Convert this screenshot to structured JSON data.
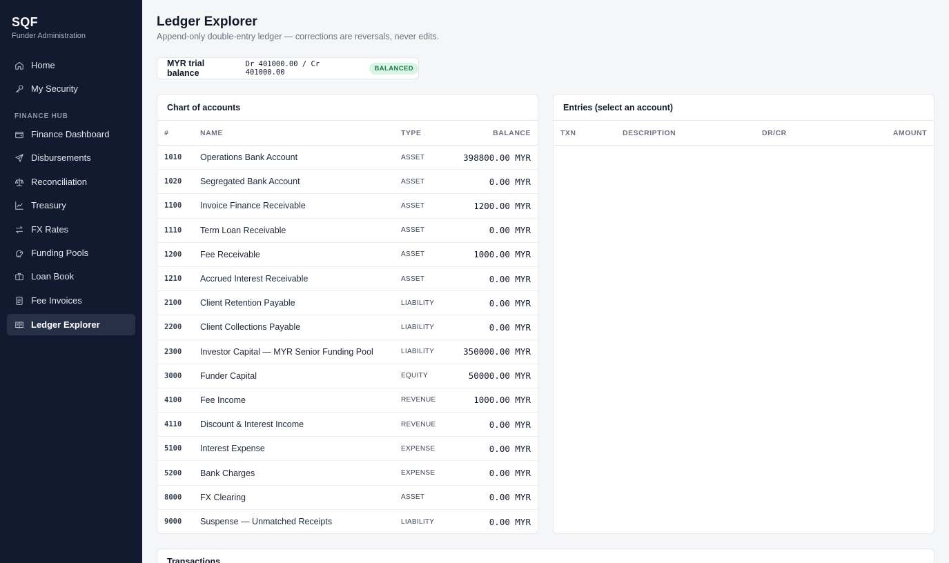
{
  "brand": {
    "title": "SQF",
    "subtitle": "Funder Administration"
  },
  "nav": {
    "top": [
      {
        "label": "Home",
        "icon": "home-icon"
      },
      {
        "label": "My Security",
        "icon": "key-icon"
      }
    ],
    "section_label": "FINANCE HUB",
    "finance": [
      {
        "label": "Finance Dashboard",
        "icon": "wallet-icon"
      },
      {
        "label": "Disbursements",
        "icon": "send-icon"
      },
      {
        "label": "Reconciliation",
        "icon": "scale-icon"
      },
      {
        "label": "Treasury",
        "icon": "line-chart-icon"
      },
      {
        "label": "FX Rates",
        "icon": "swap-icon"
      },
      {
        "label": "Funding Pools",
        "icon": "piggy-bank-icon"
      },
      {
        "label": "Loan Book",
        "icon": "briefcase-icon"
      },
      {
        "label": "Fee Invoices",
        "icon": "receipt-icon"
      },
      {
        "label": "Ledger Explorer",
        "icon": "book-icon",
        "active": true
      }
    ]
  },
  "page": {
    "title": "Ledger Explorer",
    "subtitle": "Append-only double-entry ledger — corrections are reversals, never edits."
  },
  "trial_balance": {
    "label": "MYR trial balance",
    "values": "Dr 401000.00 / Cr 401000.00",
    "status": "BALANCED"
  },
  "accounts": {
    "title": "Chart of accounts",
    "columns": {
      "num": "#",
      "name": "NAME",
      "type": "TYPE",
      "balance": "BALANCE"
    },
    "rows": [
      {
        "num": "1010",
        "name": "Operations Bank Account",
        "type": "ASSET",
        "balance": "398800.00 MYR"
      },
      {
        "num": "1020",
        "name": "Segregated Bank Account",
        "type": "ASSET",
        "balance": "0.00 MYR"
      },
      {
        "num": "1100",
        "name": "Invoice Finance Receivable",
        "type": "ASSET",
        "balance": "1200.00 MYR"
      },
      {
        "num": "1110",
        "name": "Term Loan Receivable",
        "type": "ASSET",
        "balance": "0.00 MYR"
      },
      {
        "num": "1200",
        "name": "Fee Receivable",
        "type": "ASSET",
        "balance": "1000.00 MYR"
      },
      {
        "num": "1210",
        "name": "Accrued Interest Receivable",
        "type": "ASSET",
        "balance": "0.00 MYR"
      },
      {
        "num": "2100",
        "name": "Client Retention Payable",
        "type": "LIABILITY",
        "balance": "0.00 MYR"
      },
      {
        "num": "2200",
        "name": "Client Collections Payable",
        "type": "LIABILITY",
        "balance": "0.00 MYR"
      },
      {
        "num": "2300",
        "name": "Investor Capital — MYR Senior Funding Pool",
        "type": "LIABILITY",
        "balance": "350000.00 MYR"
      },
      {
        "num": "3000",
        "name": "Funder Capital",
        "type": "EQUITY",
        "balance": "50000.00 MYR"
      },
      {
        "num": "4100",
        "name": "Fee Income",
        "type": "REVENUE",
        "balance": "1000.00 MYR"
      },
      {
        "num": "4110",
        "name": "Discount & Interest Income",
        "type": "REVENUE",
        "balance": "0.00 MYR"
      },
      {
        "num": "5100",
        "name": "Interest Expense",
        "type": "EXPENSE",
        "balance": "0.00 MYR"
      },
      {
        "num": "5200",
        "name": "Bank Charges",
        "type": "EXPENSE",
        "balance": "0.00 MYR"
      },
      {
        "num": "8000",
        "name": "FX Clearing",
        "type": "ASSET",
        "balance": "0.00 MYR"
      },
      {
        "num": "9000",
        "name": "Suspense — Unmatched Receipts",
        "type": "LIABILITY",
        "balance": "0.00 MYR"
      }
    ]
  },
  "entries": {
    "title": "Entries (select an account)",
    "columns": {
      "txn": "TXN",
      "description": "DESCRIPTION",
      "drcr": "DR/CR",
      "amount": "AMOUNT"
    }
  },
  "transactions": {
    "title": "Transactions"
  },
  "colors": {
    "sidebar": "#111a2e",
    "active_nav": "#263147",
    "badge_bg": "#d9f4e4",
    "badge_text": "#1e7a46"
  }
}
